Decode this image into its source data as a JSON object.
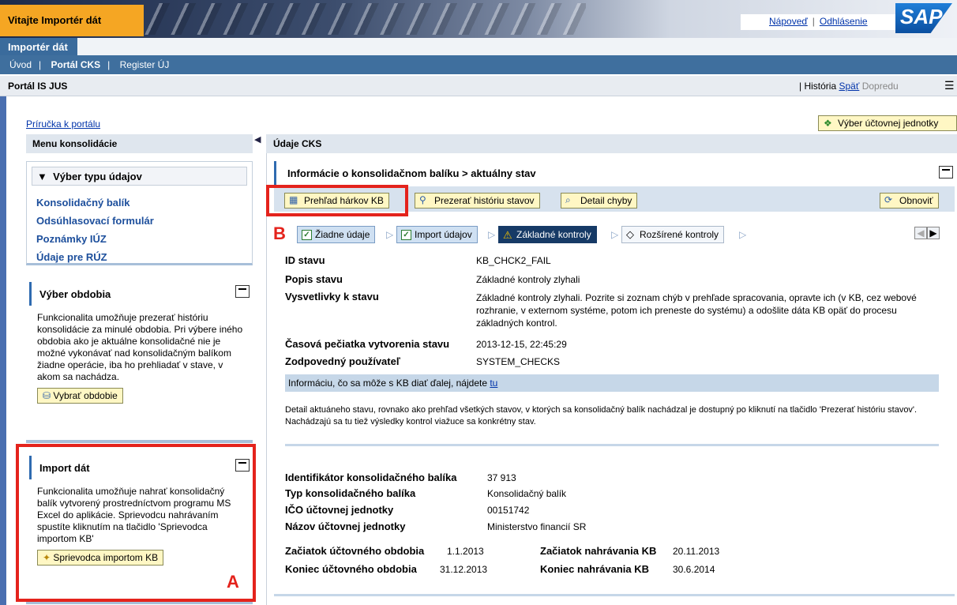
{
  "header": {
    "welcome": "Vitajte Importér dát",
    "help_link": "Nápoveď",
    "logout_link": "Odhlásenie",
    "logo": "SAP"
  },
  "nav": {
    "app_tab": "Importér dát",
    "items": [
      {
        "label": "Úvod",
        "active": false
      },
      {
        "label": "Portál CKS",
        "active": true
      },
      {
        "label": "Register ÚJ",
        "active": false
      }
    ],
    "page_title": "Portál IS JUS",
    "history": "História",
    "back": "Späť",
    "forward": "Dopredu"
  },
  "left": {
    "guide_link": "Príručka k portálu",
    "menu_header": "Menu konsolidácie",
    "type_panel": {
      "title": "Výber typu údajov",
      "items": [
        "Konsolidačný balík",
        "Odsúhlasovací formulár",
        "Poznámky IÚZ",
        "Údaje pre RÚZ"
      ]
    },
    "period_panel": {
      "title": "Výber obdobia",
      "text": "Funkcionalita umožňuje prezerať históriu konsolidácie za minulé obdobia. Pri výbere iného obdobia ako je aktuálne konsolidačné nie je možné vykonávať nad konsolidačným balíkom žiadne operácie, iba ho prehliadať v stave, v akom sa nachádza.",
      "button": "Vybrať obdobie"
    },
    "import_panel": {
      "title": "Import dát",
      "text": "Funkcionalita umožňuje nahrať konsolidačný balík vytvorený prostredníctvom programu MS Excel do aplikácie. Sprievodcu nahrávaním spustíte kliknutím na tlačidlo 'Sprievodca importom KB'",
      "button": "Sprievodca importom KB"
    },
    "annotation": "A"
  },
  "right": {
    "select_unit_button": "Výber účtovnej jednotky",
    "header": "Údaje CKS",
    "info_title": "Informácie o konsolidačnom balíku > aktuálny stav",
    "toolbar": {
      "overview": "Prehľad hárkov KB",
      "history": "Prezerať históriu stavov",
      "error_detail": "Detail chyby",
      "refresh": "Obnoviť"
    },
    "annotation": "B",
    "steps": [
      {
        "label": "Žiadne údaje",
        "state": "done"
      },
      {
        "label": "Import údajov",
        "state": "done"
      },
      {
        "label": "Základné kontroly",
        "state": "warning"
      },
      {
        "label": "Rozšírené kontroly",
        "state": "pending"
      }
    ],
    "status": {
      "id_label": "ID stavu",
      "id_value": "KB_CHCK2_FAIL",
      "desc_label": "Popis stavu",
      "desc_value": "Základné kontroly zlyhali",
      "expl_label": "Vysvetlivky k stavu",
      "expl_value": "Základné kontroly zlyhali. Pozrite si zoznam chýb v prehľade spracovania, opravte ich (v KB, cez webové rozhranie, v externom systéme, potom ich preneste do systému) a odošlite dáta KB opäť do procesu základných kontrol.",
      "ts_label": "Časová pečiatka vytvorenia stavu",
      "ts_value": "2013-12-15, 22:45:29",
      "user_label": "Zodpovedný používateľ",
      "user_value": "SYSTEM_CHECKS"
    },
    "next_info_text": "Informáciu, čo sa môže s KB diať ďalej, nájdete",
    "next_info_link": "tu",
    "detail_text": "Detail aktuáneho stavu, rovnako ako prehľad všetkých stavov, v ktorých sa konsolidačný balík nachádzal je dostupný po kliknutí na tlačidlo 'Prezerať históriu stavov'. Nachádzajú sa tu tiež výsledky kontrol viažuce sa konkrétny stav.",
    "package": {
      "id_label": "Identifikátor konsolidačného balíka",
      "id_value": "37 913",
      "type_label": "Typ konsolidačného balíka",
      "type_value": "Konsolidačný balík",
      "ico_label": "IČO účtovnej jednotky",
      "ico_value": "00151742",
      "name_label": "Názov účtovnej jednotky",
      "name_value": "Ministerstvo financií SR",
      "start_period_label": "Začiatok účtovného obdobia",
      "start_period_value": "1.1.2013",
      "end_period_label": "Koniec účtovného obdobia",
      "end_period_value": "31.12.2013",
      "start_upload_label": "Začiatok nahrávania KB",
      "start_upload_value": "20.11.2013",
      "end_upload_label": "Koniec nahrávania KB",
      "end_upload_value": "30.6.2014"
    }
  }
}
